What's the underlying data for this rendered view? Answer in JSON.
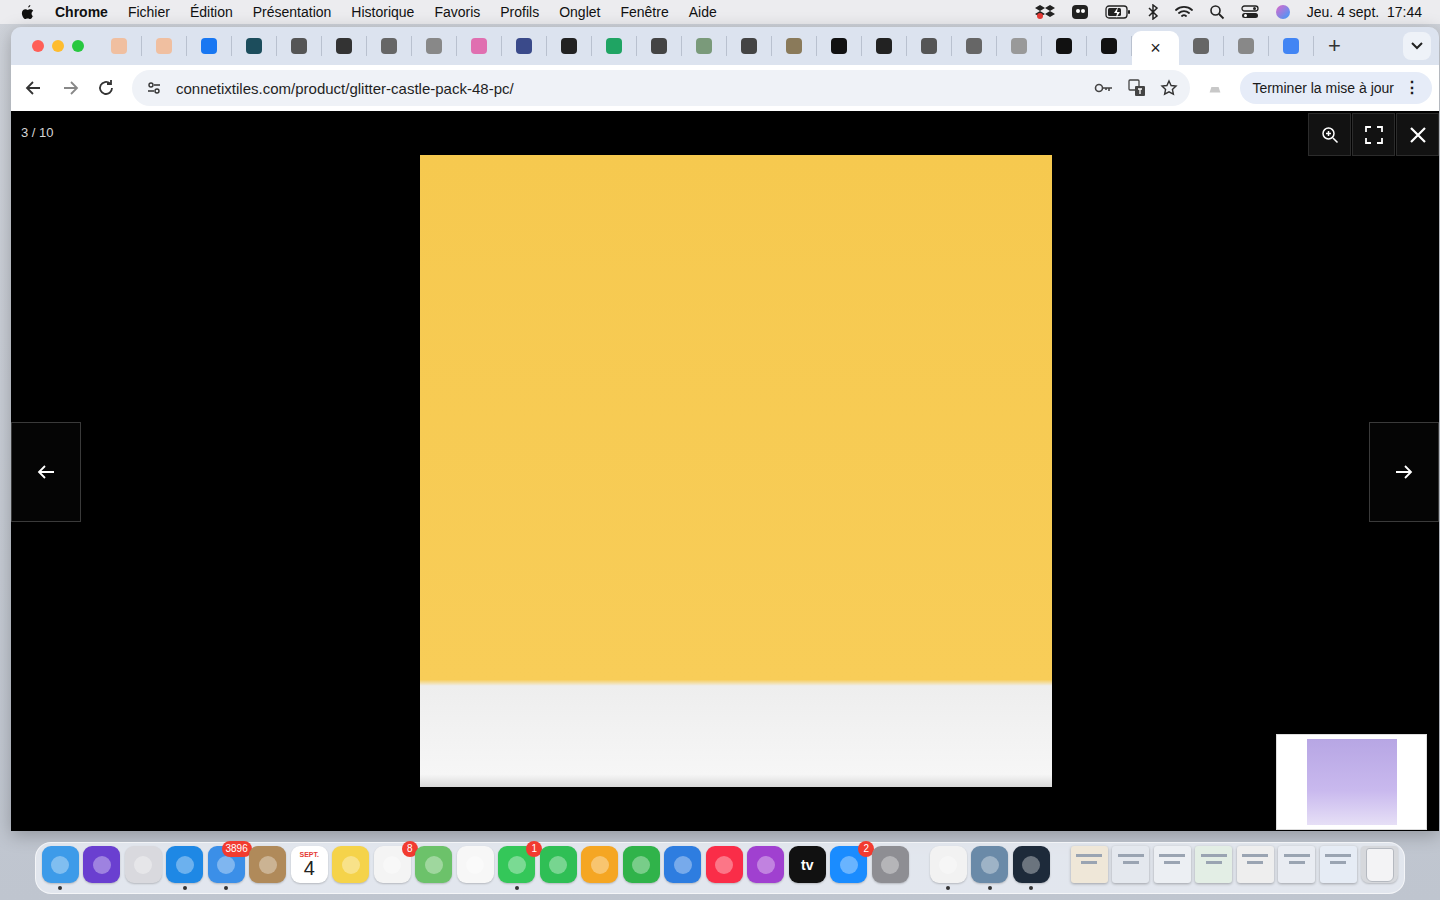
{
  "menubar": {
    "app": "Chrome",
    "items": [
      "Fichier",
      "Édition",
      "Présentation",
      "Historique",
      "Favoris",
      "Profils",
      "Onglet",
      "Fenêtre",
      "Aide"
    ],
    "clock": "Jeu. 4 sept.  17:44"
  },
  "tabs": [
    {
      "selected": false,
      "color": "#f0bfa0"
    },
    {
      "selected": false,
      "color": "#f0bfa0"
    },
    {
      "selected": false,
      "color": "#1877f2"
    },
    {
      "selected": false,
      "color": "#1c4d5c"
    },
    {
      "selected": false,
      "color": "#555555"
    },
    {
      "selected": false,
      "color": "#333333"
    },
    {
      "selected": false,
      "color": "#666666"
    },
    {
      "selected": false,
      "color": "#888888"
    },
    {
      "selected": false,
      "color": "#e06fb0"
    },
    {
      "selected": false,
      "color": "#3a4a8a"
    },
    {
      "selected": false,
      "color": "#222222"
    },
    {
      "selected": false,
      "color": "#1fa463"
    },
    {
      "selected": false,
      "color": "#444444"
    },
    {
      "selected": false,
      "color": "#7a9a7a"
    },
    {
      "selected": false,
      "color": "#444444"
    },
    {
      "selected": false,
      "color": "#8a7a5a"
    },
    {
      "selected": false,
      "color": "#111111"
    },
    {
      "selected": false,
      "color": "#222222"
    },
    {
      "selected": false,
      "color": "#555555"
    },
    {
      "selected": false,
      "color": "#666666"
    },
    {
      "selected": false,
      "color": "#999999"
    },
    {
      "selected": false,
      "color": "#111111"
    },
    {
      "selected": false,
      "color": "#111111"
    },
    {
      "selected": true,
      "color": "#ffffff"
    },
    {
      "selected": false,
      "color": "#666666"
    },
    {
      "selected": false,
      "color": "#888888"
    },
    {
      "selected": false,
      "color": "#4285f4"
    }
  ],
  "tab_close": "×",
  "new_tab": "+",
  "toolbar": {
    "url": "connetixtiles.com/product/glitter-castle-pack-48-pc/",
    "update_button": "Terminer la mise à jour",
    "menu": "⋮"
  },
  "lightbox": {
    "counter": "3 / 10"
  },
  "dock": [
    {
      "kind": "app",
      "color": "#3d9be9",
      "badge": null,
      "running": true
    },
    {
      "kind": "app",
      "color": "#6a3fd0",
      "badge": null,
      "running": false
    },
    {
      "kind": "app",
      "color": "#d9d9de",
      "badge": null,
      "running": false
    },
    {
      "kind": "app",
      "color": "#1e88e5",
      "badge": null,
      "running": true
    },
    {
      "kind": "app",
      "color": "#3b8fe8",
      "badge": "3896",
      "running": true
    },
    {
      "kind": "app",
      "color": "#b08a5a",
      "badge": null,
      "running": false
    },
    {
      "kind": "calendar",
      "color": "#ffffff",
      "badge": null,
      "running": false,
      "month": "SEPT.",
      "day": "4"
    },
    {
      "kind": "app",
      "color": "#f5d34a",
      "badge": null,
      "running": false
    },
    {
      "kind": "app",
      "color": "#f4f4f4",
      "badge": "8",
      "running": false
    },
    {
      "kind": "app",
      "color": "#6cc26a",
      "badge": null,
      "running": false
    },
    {
      "kind": "app",
      "color": "#f7f7f7",
      "badge": null,
      "running": false
    },
    {
      "kind": "app",
      "color": "#34c759",
      "badge": "1",
      "running": true
    },
    {
      "kind": "app",
      "color": "#2fbf55",
      "badge": null,
      "running": false
    },
    {
      "kind": "app",
      "color": "#f5a623",
      "badge": null,
      "running": false
    },
    {
      "kind": "app",
      "color": "#30b34a",
      "badge": null,
      "running": false
    },
    {
      "kind": "app",
      "color": "#2e7de0",
      "badge": null,
      "running": false
    },
    {
      "kind": "app",
      "color": "#fa2d48",
      "badge": null,
      "running": false
    },
    {
      "kind": "app",
      "color": "#a040d0",
      "badge": null,
      "running": false
    },
    {
      "kind": "tv",
      "color": "#111111",
      "badge": null,
      "running": false,
      "label": "tv"
    },
    {
      "kind": "app",
      "color": "#1a8cff",
      "badge": "2",
      "running": false
    },
    {
      "kind": "app",
      "color": "#8e8e93",
      "badge": null,
      "running": false
    },
    {
      "kind": "separator",
      "color": "#9a9aa0",
      "badge": null,
      "running": false
    },
    {
      "kind": "app",
      "color": "#f2f2f2",
      "badge": null,
      "running": true
    },
    {
      "kind": "app",
      "color": "#6a8aa8",
      "badge": null,
      "running": true
    },
    {
      "kind": "app",
      "color": "#1d2a3a",
      "badge": null,
      "running": true
    },
    {
      "kind": "separator",
      "color": "#9a9aa0",
      "badge": null,
      "running": false
    },
    {
      "kind": "window",
      "color": "#efe7d8",
      "badge": null,
      "running": false
    },
    {
      "kind": "window",
      "color": "#e4e8ee",
      "badge": null,
      "running": false
    },
    {
      "kind": "window",
      "color": "#eceff3",
      "badge": null,
      "running": false
    },
    {
      "kind": "window",
      "color": "#e3eee5",
      "badge": null,
      "running": false
    },
    {
      "kind": "window",
      "color": "#eeeeee",
      "badge": null,
      "running": false
    },
    {
      "kind": "window",
      "color": "#e9ecf2",
      "badge": null,
      "running": false
    },
    {
      "kind": "window",
      "color": "#e6ecf5",
      "badge": null,
      "running": false
    },
    {
      "kind": "trash",
      "color": "#d6d8dc",
      "badge": null,
      "running": false
    }
  ]
}
